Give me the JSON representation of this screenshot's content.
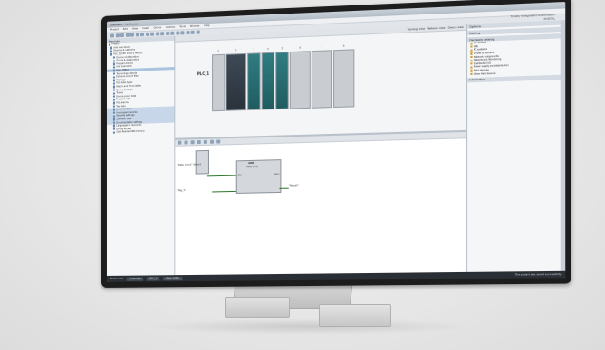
{
  "app": {
    "title": "Siemens - TIA Portal",
    "brand_line1": "Totally Integrated Automation",
    "brand_line2": "PORTAL"
  },
  "menu": [
    "Project",
    "Edit",
    "View",
    "Insert",
    "Online",
    "Options",
    "Tools",
    "Window",
    "Help"
  ],
  "project_tree": {
    "header": "Devices",
    "items": [
      "Project",
      "Add new device",
      "Devices & networks",
      "PLC_1 [CPU 1516-3 PN/DP]",
      "Device configuration",
      "Online & diagnostics",
      "Program blocks",
      "Add new block",
      "Main [OB1]",
      "Technology objects",
      "External source files",
      "PLC tags",
      "PLC data types",
      "Watch and force tables",
      "Online backups",
      "Traces",
      "Device proxy data",
      "Program info",
      "PLC alarms",
      "Text lists",
      "Local modules",
      "Ungrouped devices",
      "Security settings",
      "Common data",
      "Documentation settings",
      "Languages & resources",
      "Online access",
      "Card Reader/USB memory"
    ]
  },
  "device_view": {
    "tabs": [
      "Topology view",
      "Network view",
      "Device view"
    ],
    "rack_label": "PLC_1",
    "slots": [
      "1",
      "2",
      "3",
      "4",
      "5",
      "6",
      "7",
      "8"
    ]
  },
  "fbd": {
    "block_title": "ADD",
    "block_sub": "Auto (Int)",
    "in1": "\"Data_block\".Value1",
    "in2": "\"Tag_1\"",
    "out": "\"Result\"",
    "en": "EN",
    "eno": "ENO"
  },
  "catalog": {
    "header": "Options",
    "section1": "Catalog",
    "section2": "Hardware catalog",
    "section3": "Information",
    "items": [
      "Controllers",
      "HMI",
      "PC systems",
      "Drives & starters",
      "Network components",
      "Detecting & Monitoring",
      "Distributed I/O",
      "Power supply and distribution",
      "Field devices",
      "Other field devices"
    ]
  },
  "status": {
    "portal_view": "Portal view",
    "overview": "Overview",
    "plc": "PLC_1",
    "main": "Main (OB1)",
    "message": "The project was saved successfully."
  },
  "colors": {
    "bezel": "#1d1d1d",
    "selection": "#aac3df",
    "io_module": "#2f7d82",
    "wire": "#2d7a2d"
  }
}
